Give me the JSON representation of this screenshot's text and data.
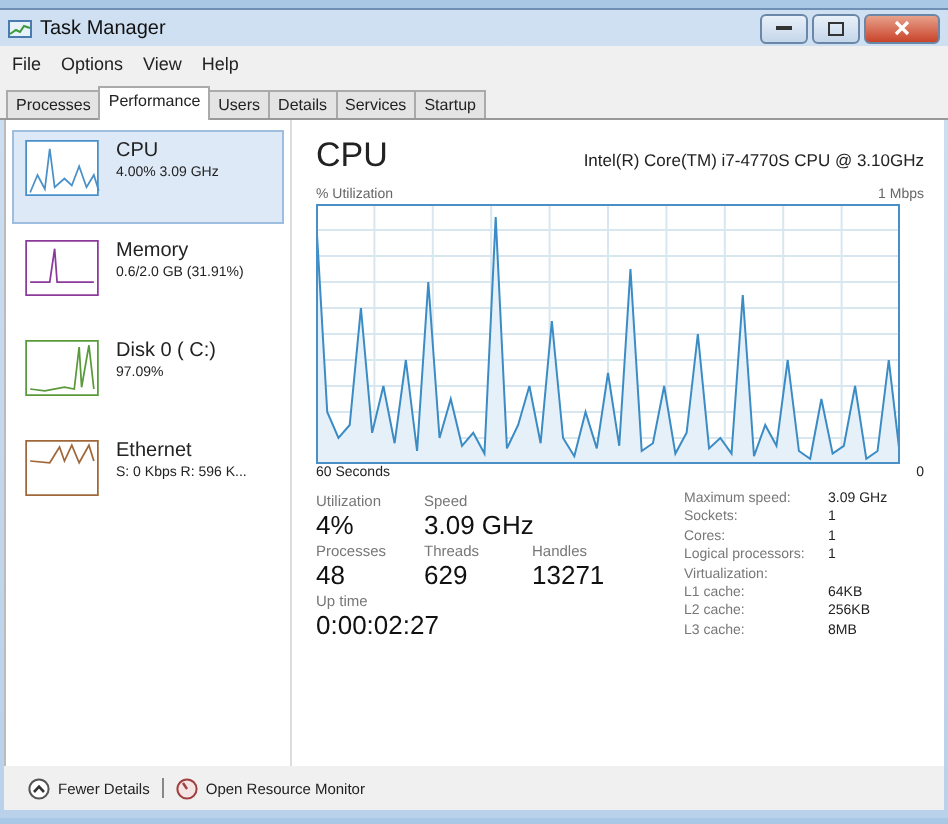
{
  "window": {
    "title": "Task Manager"
  },
  "menu": [
    "File",
    "Options",
    "View",
    "Help"
  ],
  "tabs": [
    {
      "label": "Processes",
      "selected": false
    },
    {
      "label": "Performance",
      "selected": true
    },
    {
      "label": "Users",
      "selected": false
    },
    {
      "label": "Details",
      "selected": false
    },
    {
      "label": "Services",
      "selected": false
    },
    {
      "label": "Startup",
      "selected": false
    }
  ],
  "sidebar": {
    "items": [
      {
        "name": "CPU",
        "detail": "4.00%  3.09 GHz",
        "color": "#4a90c8",
        "selected": true
      },
      {
        "name": "Memory",
        "detail": "0.6/2.0 GB (31.91%)",
        "color": "#8b3a9b",
        "selected": false
      },
      {
        "name": "Disk 0 ( C:)",
        "detail": "97.09%",
        "color": "#5a9a3a",
        "selected": false
      },
      {
        "name": "Ethernet",
        "detail": "S: 0 Kbps R: 596 K...",
        "color": "#a0683a",
        "selected": false
      }
    ]
  },
  "panel": {
    "title": "CPU",
    "model": "Intel(R) Core(TM) i7-4770S CPU @ 3.10GHz",
    "graph_label": "% Utilization",
    "graph_max": "1 Mbps",
    "x_start": "60 Seconds",
    "x_end": "0",
    "stats": [
      {
        "label": "Utilization",
        "value": "4%"
      },
      {
        "label": "Speed",
        "value": "3.09 GHz"
      },
      {
        "label": "Processes",
        "value": "48"
      },
      {
        "label": "Threads",
        "value": "629"
      },
      {
        "label": "Handles",
        "value": "13271"
      },
      {
        "label": "Up time",
        "value": "0:00:02:27"
      }
    ],
    "specs": [
      {
        "label": "Maximum speed:",
        "value": "3.09 GHz"
      },
      {
        "label": "Sockets:",
        "value": "1"
      },
      {
        "label": "Cores:",
        "value": "1"
      },
      {
        "label": "Logical processors:",
        "value": "1"
      },
      {
        "label": "Virtualization:"
      },
      {
        "label": "L1 cache:",
        "value": "64KB"
      },
      {
        "label": "L2 cache:",
        "value": "256KB"
      },
      {
        "label": "L3 cache:",
        "value": "8MB"
      }
    ]
  },
  "footer": {
    "fewer": "Fewer Details",
    "monitor": "Open Resource Monitor"
  }
}
